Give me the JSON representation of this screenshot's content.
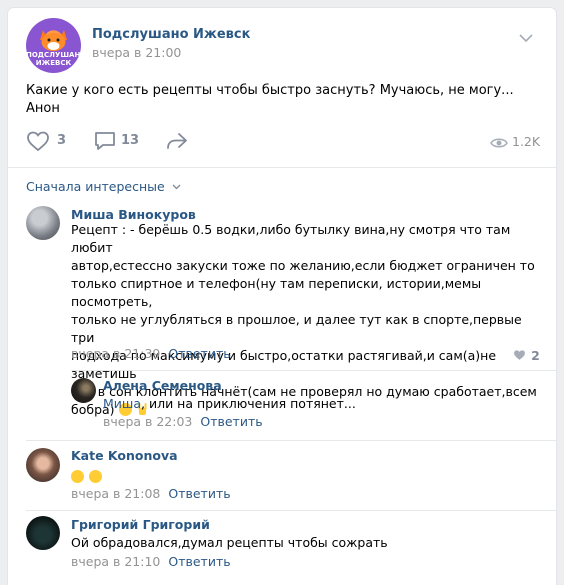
{
  "post": {
    "group_name": "Подслушано Ижевск",
    "logo_text": "ПОДСЛУШАНО ИЖЕВСК",
    "time": "вчера в 21:00",
    "text": "Какие у кого есть рецепты чтобы быстро заснуть? Мучаюсь, не могу... Анон",
    "likes": "3",
    "comments": "13",
    "views": "1.2K",
    "icons": [
      "heart-icon",
      "comment-icon",
      "share-icon",
      "eye-icon",
      "chevron-down-icon"
    ]
  },
  "sort_label": "Сначала интересные",
  "comments": [
    {
      "name": "Миша Винокуров",
      "lines": [
        "Рецепт : - берёшь 0.5 водки,либо бутылку вина,ну смотря что там любит",
        "автор,естессно закуски тоже по желанию,если бюджет ограничен то",
        "только спиртное и телефон(ну там переписки, истории,мемы посмотреть,",
        "только не углубляться в прошлое, и далее тут как в спорте,первые три",
        "подхода по максимуму и быстро,остатки растягивай,и сам(а)не заметишь",
        "как в сон клонтить начнёт(сам не проверял но думаю сработает,всем",
        "бобра)"
      ],
      "time": "вчера в 21:39",
      "reply": "Ответить",
      "likes": "2"
    },
    {
      "name": "Алена Семенова",
      "mention": "Миша",
      "text": ", или на приключения потянет...",
      "time": "вчера в 22:03",
      "reply": "Ответить"
    },
    {
      "name": "Kate Kononova",
      "time": "вчера в 21:08",
      "reply": "Ответить"
    },
    {
      "name": "Григорий Григорий",
      "text": "Ой обрадовался,думал рецепты чтобы сожрать",
      "time": "вчера в 21:10",
      "reply": "Ответить"
    }
  ],
  "colors": {
    "link": "#2a5885",
    "muted": "#939393",
    "icon": "#828a99",
    "background": "#edeef0"
  }
}
